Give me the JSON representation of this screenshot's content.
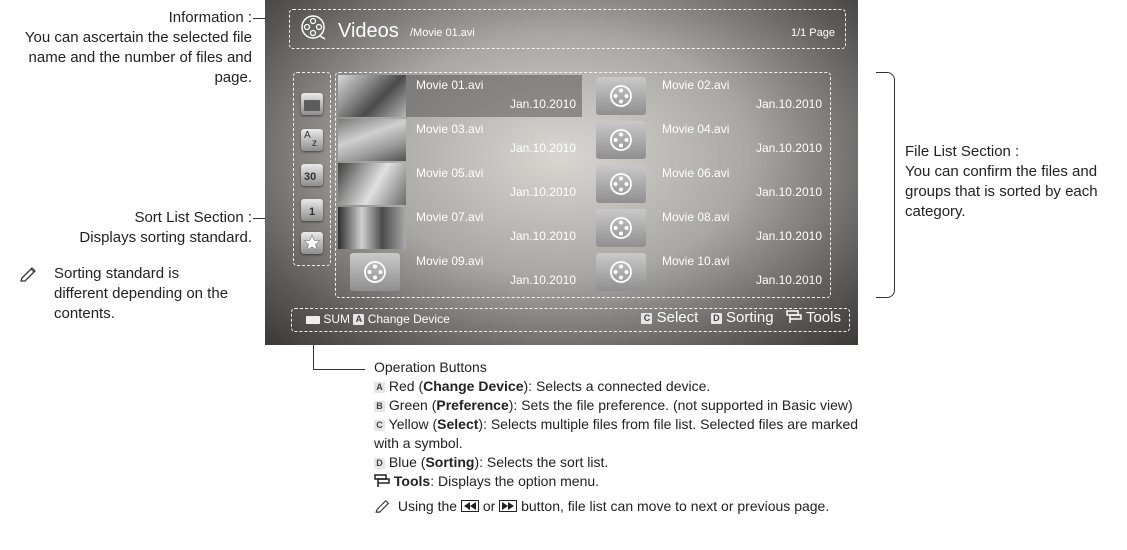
{
  "annotations": {
    "information": {
      "title": "Information :",
      "line1": "You can ascertain the selected file",
      "line2": "name and the number of files and",
      "line3": "page."
    },
    "sort_list": {
      "title": "Sort List Section :",
      "desc": "Displays sorting standard."
    },
    "sorting_note": {
      "line1": "Sorting standard is",
      "line2": "different depending on the",
      "line3": "contents."
    },
    "file_list": {
      "title": "File List Section :",
      "line1": "You can confirm the files and",
      "line2": "groups that is sorted by each",
      "line3": "category."
    },
    "operation": {
      "title": "Operation Buttons",
      "red_key": "A",
      "red_prefix": "Red (",
      "red_name": "Change Device",
      "red_desc": "): Selects a connected device.",
      "green_key": "B",
      "green_prefix": "Green (",
      "green_name": "Preference",
      "green_desc": "): Sets the file preference. (not supported in Basic view)",
      "yellow_key": "C",
      "yellow_prefix": "Yellow (",
      "yellow_name": "Select",
      "yellow_desc": "): Selects multiple files from file list. Selected files are marked",
      "yellow_desc2": "with a symbol.",
      "blue_key": "D",
      "blue_prefix": "Blue (",
      "blue_name": "Sorting",
      "blue_desc": "): Selects the sort list.",
      "tools_name": "Tools",
      "tools_desc": ": Displays the option menu.",
      "note_prefix": "Using the",
      "note_or": "or",
      "note_suffix": "button, file list can move to next or previous page."
    }
  },
  "screen": {
    "header": {
      "title": "Videos",
      "path": "/Movie 01.avi",
      "page": "1/1 Page"
    },
    "files": [
      {
        "name": "Movie 01.avi",
        "date": "Jan.10.2010",
        "thumb": "photo",
        "selected": true
      },
      {
        "name": "Movie 02.avi",
        "date": "Jan.10.2010",
        "thumb": "reel-icon",
        "selected": false
      },
      {
        "name": "Movie 03.avi",
        "date": "Jan.10.2010",
        "thumb": "photo",
        "selected": false
      },
      {
        "name": "Movie 04.avi",
        "date": "Jan.10.2010",
        "thumb": "reel-icon",
        "selected": false
      },
      {
        "name": "Movie 05.avi",
        "date": "Jan.10.2010",
        "thumb": "photo",
        "selected": false
      },
      {
        "name": "Movie 06.avi",
        "date": "Jan.10.2010",
        "thumb": "reel-icon",
        "selected": false
      },
      {
        "name": "Movie 07.avi",
        "date": "Jan.10.2010",
        "thumb": "photo",
        "selected": false
      },
      {
        "name": "Movie 08.avi",
        "date": "Jan.10.2010",
        "thumb": "reel-icon",
        "selected": false
      },
      {
        "name": "Movie 09.avi",
        "date": "Jan.10.2010",
        "thumb": "reel-icon",
        "selected": false
      },
      {
        "name": "Movie 10.avi",
        "date": "Jan.10.2010",
        "thumb": "reel-icon",
        "selected": false
      }
    ],
    "sort_icons": [
      "folder-icon",
      "alphabet-icon",
      "calendar-30-icon",
      "calendar-1-icon",
      "star-icon"
    ],
    "sort_icon_labels": {
      "alphabet_a": "A",
      "alphabet_z": "z",
      "cal30": "30",
      "cal1": "1"
    },
    "footer": {
      "sum_label": "SUM",
      "a_key": "A",
      "change_device": "Change Device",
      "c_key": "C",
      "select": "Select",
      "d_key": "D",
      "sorting": "Sorting",
      "tools": "Tools"
    }
  }
}
